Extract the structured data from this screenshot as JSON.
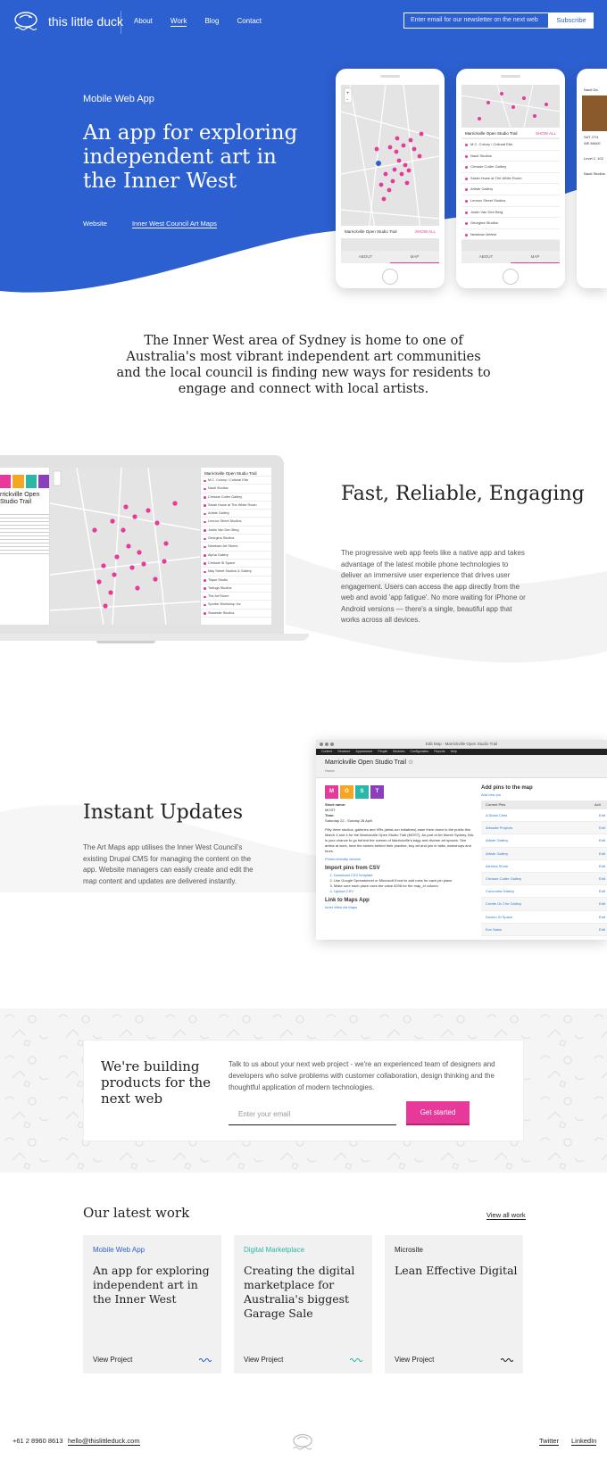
{
  "brand": {
    "name": "this little duck"
  },
  "nav": {
    "items": [
      "About",
      "Work",
      "Blog",
      "Contact"
    ],
    "active": "Work"
  },
  "newsletter": {
    "placeholder": "Enter email for our newsletter on the next web",
    "button": "Subscribe"
  },
  "hero": {
    "kicker": "Mobile Web App",
    "title": "An app for exploring independent art in the Inner West",
    "link_primary": "Website",
    "link_secondary": "Inner West Council Art Maps"
  },
  "phone": {
    "trail_name": "Marrickville Open Studio Trail",
    "show_all": "SHOW ALL",
    "tab_about": "ABOUT",
    "tab_map": "MAP",
    "places": [
      "M.C. Colony / Cultural Ebb",
      "Nauti Studios",
      "Chrissie Cotter Gallery",
      "Sarah Howe at The White Room",
      "Artiste Gallery",
      "Lennox Street Studios",
      "Justin Van Den Berg",
      "Georgina Studios",
      "Newtown Artfest"
    ],
    "third_detail": [
      "Nauti Da",
      "SAT 27/4",
      "WE MAKE",
      "Level 2, 102",
      "Nauti Studios"
    ]
  },
  "intro": "The Inner West area of Sydney is home to one of Australia's most vibrant independent art communities and the local council is finding new ways for residents to engage and connect with local artists.",
  "laptop": {
    "side_title": "rrickville Open Studio Trail",
    "places": [
      "M.C. Colony / Cultural Ebb",
      "Nauti Studios",
      "Chrissie Cotter Gallery",
      "Sarah Howe at The White Room",
      "Artiste Gallery",
      "Lennox Street Studios",
      "Justin Van Den Berg",
      "Georgina Studios",
      "Newtown Art Stores",
      "Alpha Gallery",
      "Chrissie St Space",
      "May Street Studios & Gallery",
      "Tilque Studio",
      "Tortuga Studios",
      "The Art Room",
      "Sporter Workshop Inc",
      "Staneslie Studios"
    ]
  },
  "feature1": {
    "title": "Fast, Reliable, Engaging",
    "body": "The progressive web app feels like a native app and takes advantage of the latest mobile phone technologies to deliver an immersive user experience that drives user engagement. Users can access the app directly from the web and avoid 'app fatigue'. No more waiting for iPhone or Android versions — there's a single, beautiful app that works across all devices."
  },
  "feature2": {
    "title": "Instant Updates",
    "body": "The Art Maps app utilises the Inner West Council's existing Drupal CMS for managing the content on the app. Website managers can easily create and edit the map content and updates are delivered instantly."
  },
  "cms": {
    "window_title": "Edit Map - Marrickville Open Studio Trail",
    "menu": [
      "Content",
      "Structure",
      "Appearance",
      "People",
      "Modules",
      "Configuration",
      "Reports",
      "Help"
    ],
    "page_title": "Marrickville Open Studio Trail",
    "crumb": "Home",
    "tiles": [
      "M",
      "O",
      "S",
      "T"
    ],
    "short_name_label": "Short name:",
    "short_name": "MOST",
    "time_label": "Time:",
    "time": "Saturday 22 - Sunday 28 April",
    "desc": "Fifty three studios, galleries and HRs (artist-run initiatives) ease them down to the public this March 3 and 4 for the Marrickville Open Studio Trail (MOST). As part of Art Month Sydney, this is your chance to go behind the scenes of Marrickville's edgy and diverse art spaces. See artists at work, hear the stories behind their practice, buy art and join in talks, workshops and tours.",
    "printer": "Printer-friendly version",
    "import_title": "Import pins from CSV",
    "import_steps": [
      "Download CSV template",
      "Use Google Spreadsheet or Microsoft Excel to add rows for each pin place",
      "Make sure each place uses the value 6208 for the map_id column.",
      "Upload CSV"
    ],
    "link_title": "Link to Maps App",
    "link_text": "Inner West Art Maps",
    "add_pins_title": "Add pins to the map",
    "add_new": "Add new pin",
    "col_current": "Current Pins",
    "col_action": "Acti",
    "pins": [
      "A Sloan Chris",
      "Artsdale Projects",
      "Artiste Gallery",
      "Artiste Gallery",
      "Alemira Shrim",
      "Chrissie Cotter Gallery",
      "Concordia Gallery",
      "Create On The Gallery",
      "Duxton St Space",
      "Eve Saies"
    ],
    "edit": "Edit"
  },
  "cta": {
    "title": "We're building products for the next web",
    "body": "Talk to us about your next web project - we're an experienced team of designers and developers who solve problems with customer collaboration, design thinking and the thoughtful application of modern technologies.",
    "placeholder": "Enter your email",
    "button": "Get started"
  },
  "work": {
    "title": "Our latest work",
    "view_all": "View all work",
    "cards": [
      {
        "category": "Mobile Web App",
        "title": "An app for exploring independent art in the Inner West",
        "cta": "View Project",
        "color": "#2c5fd0"
      },
      {
        "category": "Digital Marketplace",
        "title": "Creating the digital marketplace for Australia's biggest Garage Sale",
        "cta": "View Project",
        "color": "#2ab7a9"
      },
      {
        "category": "Microsite",
        "title": "Lean Effective Digital",
        "cta": "View Project",
        "color": "#222222"
      }
    ]
  },
  "footer": {
    "phone": "+61 2 8960 8613",
    "email": "hello@thislittleduck.com",
    "twitter": "Twitter",
    "linkedin": "LinkedIn"
  },
  "colors": {
    "brand_blue": "#2c5fd0",
    "accent_pink": "#e6399a",
    "teal": "#2ab7a9"
  }
}
